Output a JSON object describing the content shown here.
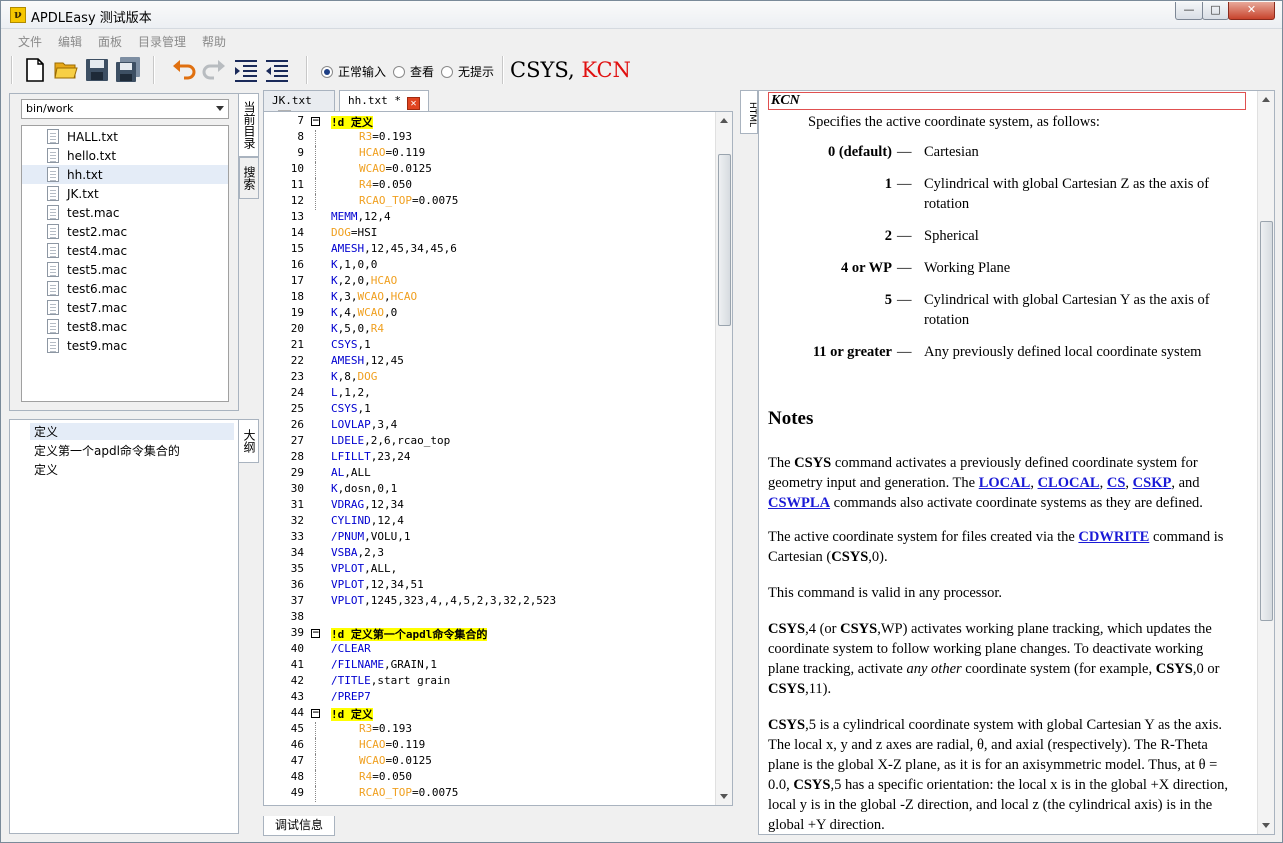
{
  "window": {
    "title": "APDLEasy 测试版本",
    "icon_label": "ν",
    "btn_min": "—",
    "btn_max": "□",
    "btn_close": "✕"
  },
  "menu": [
    "文件",
    "编辑",
    "面板",
    "目录管理",
    "帮助"
  ],
  "toolbar": {
    "icons": [
      "new-file-icon",
      "open-folder-icon",
      "save-icon",
      "save-all-icon",
      "undo-icon",
      "redo-icon",
      "indent-icon",
      "outdent-icon"
    ],
    "radios": [
      {
        "label": "正常输入",
        "checked": true
      },
      {
        "label": "查看",
        "checked": false
      },
      {
        "label": "无提示",
        "checked": false
      }
    ],
    "cmd_hint": {
      "command": "CSYS",
      "separator": ", ",
      "arg": "KCN"
    }
  },
  "left_panel": {
    "dir_combo": "bin/work",
    "files": [
      "HALL.txt",
      "hello.txt",
      "hh.txt",
      "JK.txt",
      "test.mac",
      "test2.mac",
      "test4.mac",
      "test5.mac",
      "test6.mac",
      "test7.mac",
      "test8.mac",
      "test9.mac"
    ],
    "selected_file": "hh.txt",
    "tab_current_dir": "当前目录",
    "tab_search": "搜索"
  },
  "outline_panel": {
    "tab_label": "大纲",
    "items": [
      "定义",
      "定义第一个apdl命令集合的",
      "定义"
    ]
  },
  "editor": {
    "tabs": [
      {
        "label": "JK.txt",
        "active": false,
        "close": "✕"
      },
      {
        "label": "hh.txt *",
        "active": true,
        "close": "✕"
      }
    ],
    "fold_glyph": "−",
    "lines": [
      {
        "n": "7",
        "fold": true,
        "ind": false,
        "parts": [
          [
            "hl",
            "!d 定义"
          ]
        ]
      },
      {
        "n": "8",
        "ind": true,
        "parts": [
          [
            "var",
            "R3"
          ],
          [
            "",
            "=0.193"
          ]
        ]
      },
      {
        "n": "9",
        "ind": true,
        "parts": [
          [
            "var",
            "HCAO"
          ],
          [
            "",
            "=0.119"
          ]
        ]
      },
      {
        "n": "10",
        "ind": true,
        "parts": [
          [
            "var",
            "WCAO"
          ],
          [
            "",
            "=0.0125"
          ]
        ]
      },
      {
        "n": "11",
        "ind": true,
        "parts": [
          [
            "var",
            "R4"
          ],
          [
            "",
            "=0.050"
          ]
        ]
      },
      {
        "n": "12",
        "ind": true,
        "parts": [
          [
            "var",
            "RCAO_TOP"
          ],
          [
            "",
            "=0.0075"
          ]
        ]
      },
      {
        "n": "13",
        "parts": [
          [
            "kw",
            "MEMM"
          ],
          [
            "",
            ",12,4"
          ]
        ]
      },
      {
        "n": "14",
        "parts": [
          [
            "var",
            "DOG"
          ],
          [
            "",
            "=HSI"
          ]
        ]
      },
      {
        "n": "15",
        "parts": [
          [
            "kw",
            "AMESH"
          ],
          [
            "",
            ",12,45,34,45,6"
          ]
        ]
      },
      {
        "n": "16",
        "parts": [
          [
            "kw",
            "K"
          ],
          [
            "",
            ",1,0,0"
          ]
        ]
      },
      {
        "n": "17",
        "parts": [
          [
            "kw",
            "K"
          ],
          [
            "",
            ",2,0,"
          ],
          [
            "var",
            "HCAO"
          ]
        ]
      },
      {
        "n": "18",
        "parts": [
          [
            "kw",
            "K"
          ],
          [
            "",
            ",3,"
          ],
          [
            "var",
            "WCAO"
          ],
          [
            "",
            ","
          ],
          [
            "var",
            "HCAO"
          ]
        ]
      },
      {
        "n": "19",
        "parts": [
          [
            "kw",
            "K"
          ],
          [
            "",
            ",4,"
          ],
          [
            "var",
            "WCAO"
          ],
          [
            "",
            ",0"
          ]
        ]
      },
      {
        "n": "20",
        "parts": [
          [
            "kw",
            "K"
          ],
          [
            "",
            ",5,0,"
          ],
          [
            "var",
            "R4"
          ]
        ]
      },
      {
        "n": "21",
        "parts": [
          [
            "kw",
            "CSYS"
          ],
          [
            "",
            ",1"
          ]
        ]
      },
      {
        "n": "22",
        "parts": [
          [
            "kw",
            "AMESH"
          ],
          [
            "",
            ",12,45"
          ]
        ]
      },
      {
        "n": "23",
        "parts": [
          [
            "kw",
            "K"
          ],
          [
            "",
            ",8,"
          ],
          [
            "var",
            "DOG"
          ]
        ]
      },
      {
        "n": "24",
        "parts": [
          [
            "kw",
            "L"
          ],
          [
            "",
            ",1,2,"
          ]
        ]
      },
      {
        "n": "25",
        "parts": [
          [
            "kw",
            "CSYS"
          ],
          [
            "",
            ",1"
          ]
        ]
      },
      {
        "n": "26",
        "parts": [
          [
            "kw",
            "LOVLAP"
          ],
          [
            "",
            ",3,4"
          ]
        ]
      },
      {
        "n": "27",
        "parts": [
          [
            "kw",
            "LDELE"
          ],
          [
            "",
            ",2,6,rcao_top"
          ]
        ]
      },
      {
        "n": "28",
        "parts": [
          [
            "kw",
            "LFILLT"
          ],
          [
            "",
            ",23,24"
          ]
        ]
      },
      {
        "n": "29",
        "parts": [
          [
            "kw",
            "AL"
          ],
          [
            "",
            ",ALL"
          ]
        ]
      },
      {
        "n": "30",
        "parts": [
          [
            "kw",
            "K"
          ],
          [
            "",
            ",dosn,0,1"
          ]
        ]
      },
      {
        "n": "31",
        "parts": [
          [
            "kw",
            "VDRAG"
          ],
          [
            "",
            ",12,34"
          ]
        ]
      },
      {
        "n": "32",
        "parts": [
          [
            "kw",
            "CYLIND"
          ],
          [
            "",
            ",12,4"
          ]
        ]
      },
      {
        "n": "33",
        "parts": [
          [
            "kw",
            "/PNUM"
          ],
          [
            "",
            ",VOLU,1"
          ]
        ]
      },
      {
        "n": "34",
        "parts": [
          [
            "kw",
            "VSBA"
          ],
          [
            "",
            ",2,3"
          ]
        ]
      },
      {
        "n": "35",
        "parts": [
          [
            "kw",
            "VPLOT"
          ],
          [
            "",
            ",ALL,"
          ]
        ]
      },
      {
        "n": "36",
        "parts": [
          [
            "kw",
            "VPLOT"
          ],
          [
            "",
            ",12,34,51"
          ]
        ]
      },
      {
        "n": "37",
        "parts": [
          [
            "kw",
            "VPLOT"
          ],
          [
            "",
            ",1245,323,4,,4,5,2,3,32,2,523"
          ]
        ]
      },
      {
        "n": "38",
        "parts": []
      },
      {
        "n": "39",
        "fold": true,
        "parts": [
          [
            "hl",
            "!d 定义第一个apdl命令集合的"
          ]
        ]
      },
      {
        "n": "40",
        "parts": [
          [
            "kw",
            "/CLEAR"
          ]
        ]
      },
      {
        "n": "41",
        "parts": [
          [
            "kw",
            "/FILNAME"
          ],
          [
            "",
            ",GRAIN,1"
          ]
        ]
      },
      {
        "n": "42",
        "parts": [
          [
            "kw",
            "/TITLE"
          ],
          [
            "",
            ",start grain"
          ]
        ]
      },
      {
        "n": "43",
        "parts": [
          [
            "kw",
            "/PREP7"
          ]
        ]
      },
      {
        "n": "44",
        "fold": true,
        "parts": [
          [
            "hl",
            "!d 定义"
          ]
        ]
      },
      {
        "n": "45",
        "ind": true,
        "parts": [
          [
            "var",
            "R3"
          ],
          [
            "",
            "=0.193"
          ]
        ]
      },
      {
        "n": "46",
        "ind": true,
        "parts": [
          [
            "var",
            "HCAO"
          ],
          [
            "",
            "=0.119"
          ]
        ]
      },
      {
        "n": "47",
        "ind": true,
        "parts": [
          [
            "var",
            "WCAO"
          ],
          [
            "",
            "=0.0125"
          ]
        ]
      },
      {
        "n": "48",
        "ind": true,
        "parts": [
          [
            "var",
            "R4"
          ],
          [
            "",
            "=0.050"
          ]
        ]
      },
      {
        "n": "49",
        "ind": true,
        "parts": [
          [
            "var",
            "RCAO_TOP"
          ],
          [
            "",
            "=0.0075"
          ]
        ]
      }
    ],
    "debug_tab": "调试信息"
  },
  "help": {
    "tab_label": "HTML",
    "heading_arg": "KCN",
    "intro": "Specifies the active coordinate system, as follows:",
    "dash": "—",
    "values": [
      {
        "key": "0 (default)",
        "text": "Cartesian"
      },
      {
        "key": "1",
        "text": "Cylindrical with global Cartesian Z as the axis of rotation"
      },
      {
        "key": "2",
        "text": "Spherical"
      },
      {
        "key": "4 or WP",
        "text": "Working Plane"
      },
      {
        "key": "5",
        "text": "Cylindrical with global Cartesian Y as the axis of rotation"
      },
      {
        "key": "11 or greater",
        "text": "Any previously defined local coordinate system"
      }
    ],
    "notes_title": "Notes",
    "p1": {
      "a": "The ",
      "b": "CSYS",
      "c": " command activates a previously defined coordinate system for geometry input and generation. The ",
      "links": [
        "LOCAL",
        "CLOCAL",
        "CS",
        "CSKP",
        "CSWPLA"
      ],
      "d": " commands also activate coordinate systems as they are defined."
    },
    "p2": {
      "a": "The active coordinate system for files created via the ",
      "link": "CDWRITE",
      "b": " command is Cartesian (",
      "c": "CSYS",
      "d": ",0)."
    },
    "p3": "This command is valid in any processor.",
    "p4": {
      "a": "CSYS",
      "b": ",4 (or ",
      "c": "CSYS",
      "d": ",WP) activates working plane tracking, which updates the coordinate system to follow working plane changes. To deactivate working plane tracking, activate ",
      "e": "any other",
      "f": " coordinate system (for example, ",
      "g": "CSYS",
      "h": ",0 or ",
      "i": "CSYS",
      "j": ",11)."
    },
    "p5": {
      "a": "CSYS",
      "b": ",5 is a cylindrical coordinate system with global Cartesian Y as the axis. The local x, y and z axes are radial, θ, and axial (respectively). The R-Theta plane is the global X-Z plane, as it is for an axisymmetric model. Thus, at θ = 0.0, ",
      "c": "CSYS",
      "d": ",5 has a specific orientation: the local x is in the global +X direction, local y is in the global -Z direction, and local z (the cylindrical axis) is in the global +Y direction."
    }
  },
  "colors": {
    "keyword": "#0000d0",
    "variable": "#f0a020",
    "highlight": "#ffff00",
    "link": "#1a1ad6",
    "cmd_arg": "#e01010"
  }
}
